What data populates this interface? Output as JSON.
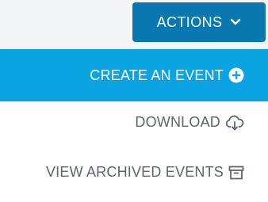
{
  "actions_button": {
    "label": "ACTIONS",
    "icon": "chevron-down-icon"
  },
  "menu": {
    "items": [
      {
        "label": "CREATE AN EVENT",
        "icon": "plus-circle-icon",
        "state": "highlighted"
      },
      {
        "label": "DOWNLOAD",
        "icon": "cloud-download-icon",
        "state": "normal"
      },
      {
        "label": "VIEW ARCHIVED EVENTS",
        "icon": "archive-icon",
        "state": "normal"
      }
    ]
  },
  "colors": {
    "actions_button_bg": "#0a78b0",
    "highlight_bg": "#0aa4e2",
    "menu_text": "#5c6470",
    "page_bg": "#f4f5f6"
  }
}
